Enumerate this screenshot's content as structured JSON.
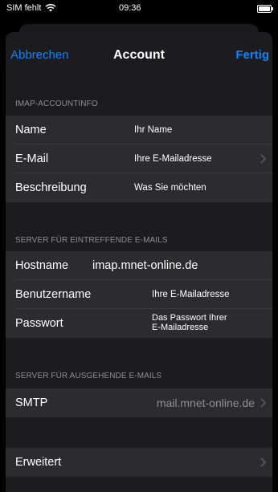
{
  "status_bar": {
    "carrier": "SIM fehlt",
    "time": "09:36"
  },
  "nav": {
    "cancel_label": "Abbrechen",
    "title": "Account",
    "done_label": "Fertig"
  },
  "imap_section": {
    "header": "IMAP-ACCOUNTINFO",
    "rows": [
      {
        "label": "Name",
        "value": "Ihr Name"
      },
      {
        "label": "E-Mail",
        "value": "Ihre E-Mailadresse"
      },
      {
        "label": "Beschreibung",
        "value": "Was  Sie möchten"
      }
    ]
  },
  "incoming_section": {
    "header": "SERVER FÜR EINTREFFENDE E-MAILS",
    "hostname": {
      "label": "Hostname",
      "value": "imap.mnet-online.de"
    },
    "username": {
      "label": "Benutzername",
      "value": "Ihre E-Mailadresse"
    },
    "password": {
      "label": "Passwort",
      "value_line1": "Das Passwort Ihrer",
      "value_line2": "E-Mailadresse"
    }
  },
  "outgoing_section": {
    "header": "SERVER FÜR AUSGEHENDE E-MAILS",
    "smtp": {
      "label": "SMTP",
      "value": "mail.mnet-online.de"
    }
  },
  "advanced": {
    "label": "Erweitert"
  },
  "colors": {
    "accent": "#0a84ff",
    "background": "#1c1c1e",
    "cell": "#2c2c2e",
    "secondary_text": "#8e8e93"
  },
  "icons": [
    "wifi-icon",
    "battery-icon",
    "chevron-right-icon"
  ]
}
